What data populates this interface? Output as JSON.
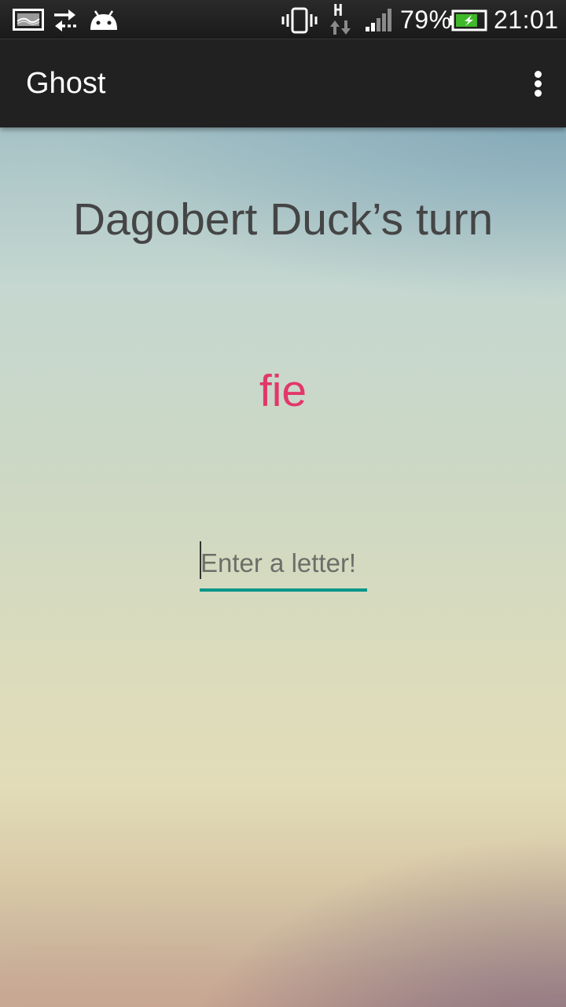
{
  "status_bar": {
    "icons": [
      "screenshot-icon",
      "sync-icon",
      "android-icon",
      "vibrate-icon",
      "hspa-data-icon",
      "signal-icon",
      "battery-charging-icon"
    ],
    "network_type": "H",
    "battery_percent": "79%",
    "battery_level": 0.79,
    "time": "21:01"
  },
  "app_bar": {
    "title": "Ghost",
    "menu_icon": "overflow-menu-icon"
  },
  "game": {
    "turn_text": "Dagobert Duck’s turn",
    "current_word": "fie",
    "input_value": "",
    "input_placeholder": "Enter a letter!"
  },
  "colors": {
    "word": "#e33769",
    "accent": "#009688",
    "turn_text": "#454545",
    "app_bar": "#212121"
  }
}
